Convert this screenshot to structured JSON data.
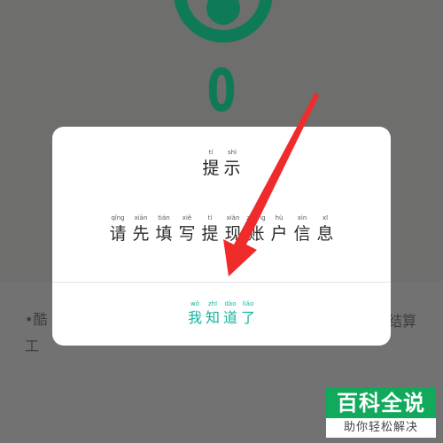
{
  "background": {
    "balance": "0",
    "text_line1": "•酷",
    "text_line2": "工",
    "text_right": "结算"
  },
  "dialog": {
    "title": [
      {
        "char": "提",
        "pinyin": "tí"
      },
      {
        "char": "示",
        "pinyin": "shì"
      }
    ],
    "message": [
      {
        "char": "请",
        "pinyin": "qǐng"
      },
      {
        "char": "先",
        "pinyin": "xiān"
      },
      {
        "char": "填",
        "pinyin": "tián"
      },
      {
        "char": "写",
        "pinyin": "xiě"
      },
      {
        "char": "提",
        "pinyin": "tí"
      },
      {
        "char": "现",
        "pinyin": "xiàn"
      },
      {
        "char": "账",
        "pinyin": "zhàng"
      },
      {
        "char": "户",
        "pinyin": "hù"
      },
      {
        "char": "信",
        "pinyin": "xìn"
      },
      {
        "char": "息",
        "pinyin": "xī"
      }
    ],
    "confirm_button": [
      {
        "char": "我",
        "pinyin": "wǒ"
      },
      {
        "char": "知",
        "pinyin": "zhī"
      },
      {
        "char": "道",
        "pinyin": "dào"
      },
      {
        "char": "了",
        "pinyin": "liǎo"
      }
    ]
  },
  "watermark": {
    "brand": "百科全说",
    "tagline": "助你轻松解决"
  },
  "colors": {
    "accent": "#13b4a0",
    "balance": "#0f7a58",
    "arrow": "#ef2b2b",
    "watermark": "#11a95c"
  }
}
